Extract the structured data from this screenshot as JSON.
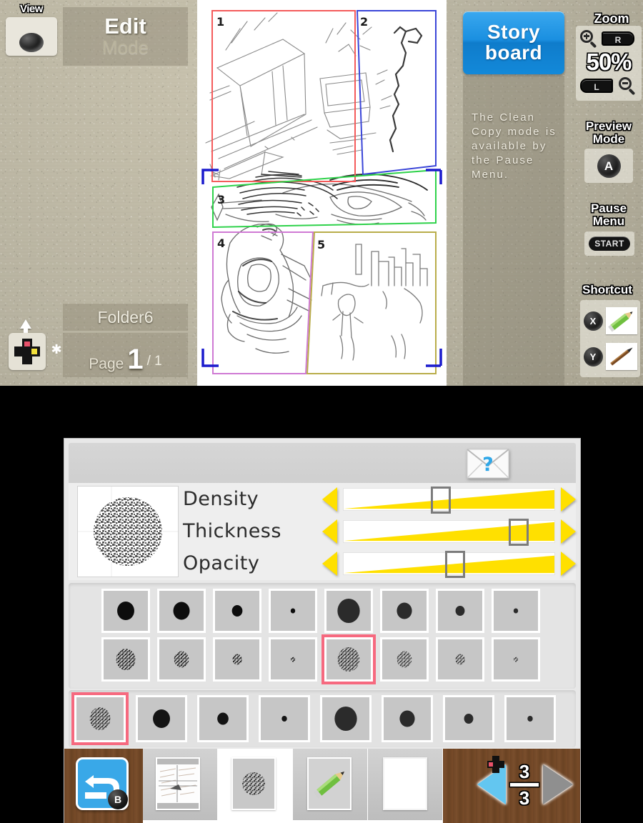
{
  "top_screen": {
    "view_button": {
      "label": "View",
      "icon": "circle-button-icon"
    },
    "mode": {
      "title": "Edit",
      "subtitle": "Mode"
    },
    "folder": {
      "name": "Folder6"
    },
    "page": {
      "word": "Page",
      "current": "1",
      "total": "/ 1"
    },
    "dpad": {
      "icon": "dpad-icon",
      "arrow_icon": "up-arrow-icon",
      "sparkle_icon": "sparkle-icon"
    },
    "storyboard_tab": {
      "line1": "Story",
      "line2": "board"
    },
    "hint": {
      "text": "The Clean Copy mode is available by the Pause Menu."
    },
    "zoom": {
      "title": "Zoom",
      "value": "50%",
      "zoom_in_icon": "magnifier-plus-icon",
      "zoom_out_icon": "magnifier-minus-icon",
      "key_r": "R",
      "key_l": "L"
    },
    "preview": {
      "title_line1": "Preview",
      "title_line2": "Mode",
      "button": "A"
    },
    "pause": {
      "title_line1": "Pause",
      "title_line2": "Menu",
      "button": "START"
    },
    "shortcut": {
      "title": "Shortcut",
      "slot1_key": "X",
      "slot1_tool": "green-pencil-icon",
      "slot2_key": "Y",
      "slot2_tool": "brown-pen-icon"
    },
    "storyboard": {
      "panels": [
        {
          "number": "1",
          "color": "#f45b5b"
        },
        {
          "number": "2",
          "color": "#3b46d8"
        },
        {
          "number": "3",
          "color": "#2fd24b"
        },
        {
          "number": "4",
          "color": "#cf7ad4"
        },
        {
          "number": "5",
          "color": "#b9ad4a"
        }
      ],
      "selection_bracket_color": "#1b1bcd"
    }
  },
  "bottom_screen": {
    "help_button": {
      "icon": "envelope-question-icon"
    },
    "brush_preview": {
      "icon": "noise-brush-icon"
    },
    "settings": [
      {
        "label": "Density",
        "value_pct": 46
      },
      {
        "label": "Thickness",
        "value_pct": 83
      },
      {
        "label": "Opacity",
        "value_pct": 53
      }
    ],
    "brush_grid": {
      "row1": [
        {
          "shape": "solid",
          "size": 26,
          "tone": "#0d0d0d"
        },
        {
          "shape": "solid",
          "size": 25,
          "tone": "#0d0d0d"
        },
        {
          "shape": "solid",
          "size": 16,
          "tone": "#0d0d0d"
        },
        {
          "shape": "solid",
          "size": 7,
          "tone": "#0d0d0d"
        },
        {
          "shape": "solid",
          "size": 34,
          "tone": "#2b2b2b"
        },
        {
          "shape": "solid",
          "size": 23,
          "tone": "#2b2b2b"
        },
        {
          "shape": "solid",
          "size": 14,
          "tone": "#2b2b2b"
        },
        {
          "shape": "solid",
          "size": 7,
          "tone": "#2b2b2b"
        }
      ],
      "row2": [
        {
          "shape": "noise",
          "size": 30,
          "tone": "#2b2b2b"
        },
        {
          "shape": "noise",
          "size": 23,
          "tone": "#2b2b2b"
        },
        {
          "shape": "noise",
          "size": 15,
          "tone": "#2b2b2b"
        },
        {
          "shape": "noise",
          "size": 7,
          "tone": "#2b2b2b"
        },
        {
          "shape": "noise",
          "size": 34,
          "tone": "#3a3a3a",
          "selected": true
        },
        {
          "shape": "noise",
          "size": 23,
          "tone": "#4a4a4a"
        },
        {
          "shape": "noise",
          "size": 15,
          "tone": "#4a4a4a"
        },
        {
          "shape": "noise",
          "size": 7,
          "tone": "#4a4a4a"
        }
      ]
    },
    "recent_strip": [
      {
        "shape": "noise",
        "size": 32,
        "tone": "#3a3a3a",
        "selected": true
      },
      {
        "shape": "solid",
        "size": 26,
        "tone": "#141414"
      },
      {
        "shape": "solid",
        "size": 17,
        "tone": "#141414"
      },
      {
        "shape": "solid",
        "size": 8,
        "tone": "#141414"
      },
      {
        "shape": "solid",
        "size": 34,
        "tone": "#2b2b2b"
      },
      {
        "shape": "solid",
        "size": 23,
        "tone": "#2b2b2b"
      },
      {
        "shape": "solid",
        "size": 14,
        "tone": "#2b2b2b"
      },
      {
        "shape": "solid",
        "size": 8,
        "tone": "#2b2b2b"
      }
    ],
    "toolbar": {
      "undo": {
        "icon": "undo-arrow-icon",
        "button": "B"
      },
      "thumbnail": {
        "icon": "page-thumbnail-icon"
      },
      "brush_slot": {
        "icon": "noise-brush-icon"
      },
      "pencil_slot": {
        "icon": "green-pencil-icon"
      },
      "color_slot": {
        "icon": "white-color-swatch-icon"
      },
      "nav": {
        "prev_icon": "left-triangle-dpad-icon",
        "next_icon": "right-triangle-icon",
        "numerator": "3",
        "denominator": "3"
      }
    }
  },
  "colors": {
    "accent_blue": "#39a8e8",
    "slider_yellow": "#ffe000",
    "selection_pink": "#f6697f",
    "top_bg": "#b8b3a0"
  }
}
